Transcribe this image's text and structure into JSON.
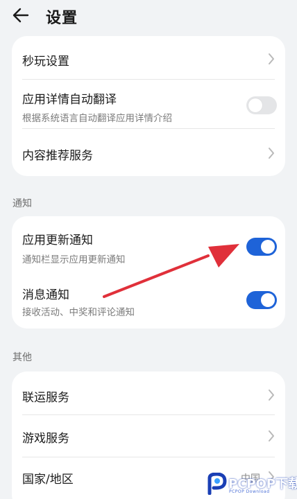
{
  "header": {
    "title": "设置",
    "back_icon": "arrow-left-icon"
  },
  "card1": {
    "rows": [
      {
        "title": "秒玩设置",
        "control": "chevron"
      },
      {
        "title": "应用详情自动翻译",
        "subtitle": "根据系统语言自动翻译应用详情介绍",
        "control": "toggle",
        "toggle_on": false
      },
      {
        "title": "内容推荐服务",
        "control": "chevron"
      }
    ]
  },
  "notify_section": {
    "label": "通知"
  },
  "card2": {
    "rows": [
      {
        "title": "应用更新通知",
        "subtitle": "通知栏显示应用更新通知",
        "control": "toggle",
        "toggle_on": true
      },
      {
        "title": "消息通知",
        "subtitle": "接收活动、中奖和评论通知",
        "control": "toggle",
        "toggle_on": true
      }
    ]
  },
  "other_section": {
    "label": "其他"
  },
  "card3": {
    "rows": [
      {
        "title": "联运服务",
        "control": "chevron"
      },
      {
        "title": "游戏服务",
        "control": "chevron"
      },
      {
        "title": "国家/地区",
        "value": "中国",
        "control": "chevron"
      }
    ]
  },
  "watermark": {
    "brand": "PCPOP下载",
    "sub": "PCPOP Download"
  },
  "colors": {
    "accent": "#1e63d8",
    "annotation_arrow": "#e0303a",
    "background": "#f1f3f5"
  }
}
